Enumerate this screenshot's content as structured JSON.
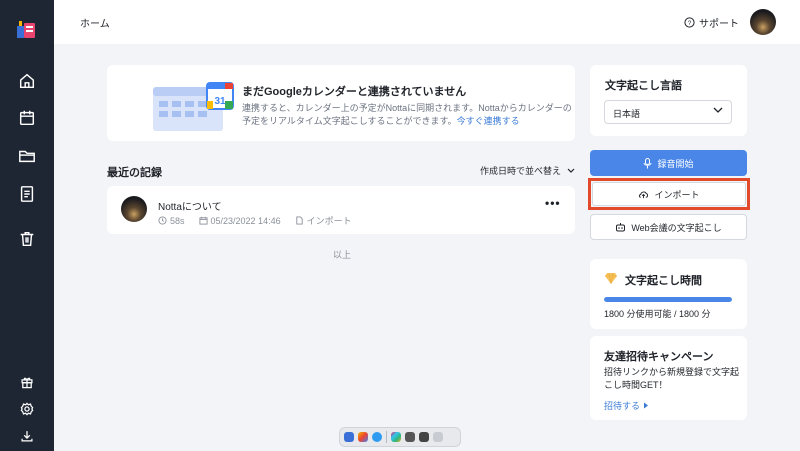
{
  "topbar": {
    "breadcrumb": "ホーム",
    "support_label": "サポート"
  },
  "banner": {
    "title": "まだGoogleカレンダーと連携されていません",
    "description": "連携すると、カレンダー上の予定がNottaに同期されます。Nottaからカレンダーの予定をリアルタイム文字起こしすることができます。",
    "link": "今すぐ連携する",
    "calendar_day": "31"
  },
  "recent": {
    "title": "最近の記録",
    "sort_label": "作成日時で並べ替え",
    "records": [
      {
        "title": "Nottaについて",
        "duration": "58s",
        "date": "05/23/2022 14:46",
        "source": "インポート"
      }
    ],
    "end_text": "以上"
  },
  "language": {
    "title": "文字起こし言語",
    "selected": "日本語"
  },
  "actions": {
    "record": "録音開始",
    "import": "インポート",
    "web_meeting": "Web会議の文字起こし"
  },
  "transcription_time": {
    "title": "文字起こし時間",
    "usage_text": "1800 分使用可能 / 1800 分",
    "progress_fraction": 1.0
  },
  "invite": {
    "title": "友達招待キャンペーン",
    "description": "招待リンクから新規登録で文字起こし時間GET！",
    "link": "招待する"
  },
  "colors": {
    "accent": "#4a86e8",
    "sidebar": "#1f2633",
    "highlight": "#e34a2b"
  }
}
